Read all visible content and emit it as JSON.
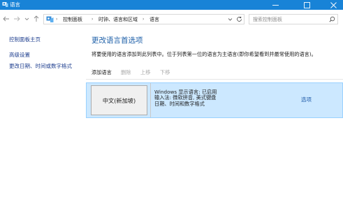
{
  "window": {
    "title": "语言",
    "app_icon": "control-panel-icon",
    "controls": [
      "minimize-icon",
      "maximize-icon",
      "close-icon"
    ]
  },
  "address": {
    "crumbs": [
      "控制面板",
      "时钟、语言和区域",
      "语言"
    ],
    "search_placeholder": "搜索控制面板"
  },
  "sidebar": {
    "items": [
      {
        "label": "控制面板主页"
      },
      {
        "label": "高级设置"
      },
      {
        "label": "更改日期、时间或数字格式"
      }
    ]
  },
  "main": {
    "title": "更改语言首选项",
    "description": "将要使用的语言添加到此列表中。位于列表第一位的语言为主语言(即你希望看到并最常使用的语言)。",
    "toolbar": [
      {
        "label": "添加语言",
        "enabled": true
      },
      {
        "label": "删除",
        "enabled": false
      },
      {
        "label": "上移",
        "enabled": false
      },
      {
        "label": "下移",
        "enabled": false
      }
    ],
    "languages": [
      {
        "name": "中文(新加坡)",
        "details": [
          "Windows 显示语言: 已启用",
          "输入法: 微软拼音, 美式键盘",
          "日期、时间和数字格式"
        ],
        "options_link": "选项"
      }
    ]
  },
  "colors": {
    "titlebar": "#1883d7",
    "selected_row": "#cce8ff",
    "link": "#1e5aa8",
    "heading": "#1d5fa8"
  }
}
